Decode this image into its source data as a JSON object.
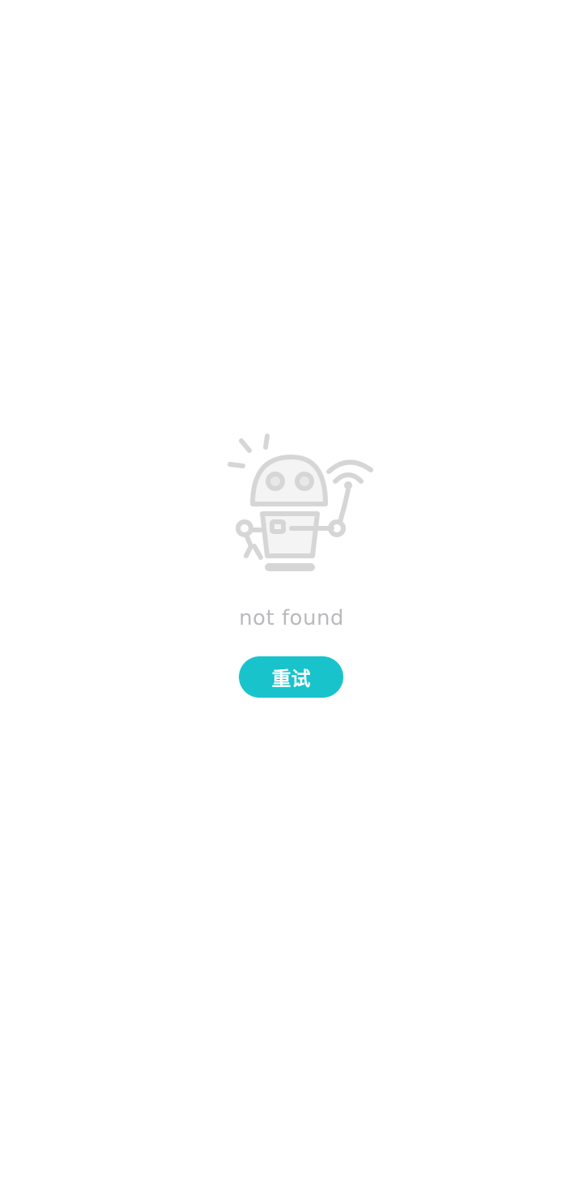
{
  "empty_state": {
    "illustration": "robot-disconnected-icon",
    "message": "not found",
    "retry_label": "重试"
  },
  "colors": {
    "background": "#ffffff",
    "illustration": "#d6d6d6",
    "message_text": "#b8babd",
    "accent": "#19c3cc"
  }
}
